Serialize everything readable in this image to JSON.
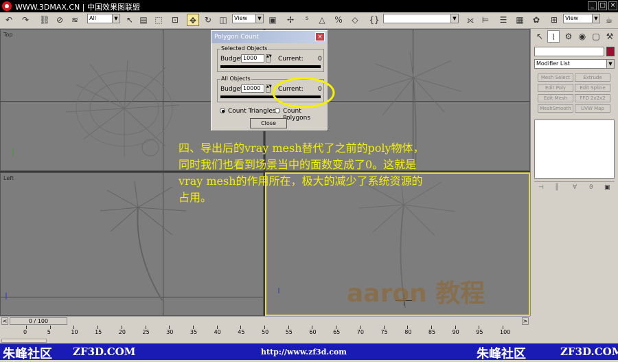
{
  "titlebar": {
    "text": "WWW.3DMAX.CN | 中国效果图联盟"
  },
  "toolbar": {
    "selection_filter": "All",
    "ref_coord": "View",
    "ref_coord_right": "View"
  },
  "viewports": {
    "top_label": "Top",
    "left_label": "Left"
  },
  "dialog": {
    "title": "Polygon Count",
    "selected": {
      "group_label": "Selected Objects",
      "budget_label": "Budget:",
      "budget_value": "1000",
      "current_label": "Current:",
      "current_value": "0"
    },
    "all": {
      "group_label": "All Objects",
      "budget_label": "Budget:",
      "budget_value": "10000",
      "current_label": "Current:",
      "current_value": "0"
    },
    "count_triangles": "Count Triangles",
    "count_polygons": "Count Polygons",
    "close_label": "Close",
    "selected_count_mode": "Count Triangles"
  },
  "command_panel": {
    "modifier_list": "Modifier List",
    "buttons": [
      "Mesh Select",
      "Extrude",
      "Edit Poly",
      "Edit Spline",
      "Edit Mesh",
      "FFD 2x2x2",
      "MeshSmooth",
      "UVW Map"
    ]
  },
  "annotation": {
    "line1": "四、导出后的vray mesh替代了之前的poly物体，",
    "line2": "同时我们也看到场景当中的面数变成了0。这就是",
    "line3": "vray mesh的作用所在，极大的减少了系统资源的",
    "line4": "占用。"
  },
  "watermark": "aaron 教程",
  "timeslider": {
    "frame": "0 / 100"
  },
  "trackbar": {
    "ticks": [
      "0",
      "5",
      "10",
      "15",
      "20",
      "25",
      "30",
      "35",
      "40",
      "45",
      "50",
      "55",
      "60",
      "65",
      "70",
      "75",
      "80",
      "85",
      "90",
      "95",
      "100"
    ]
  },
  "footer": {
    "left_brand": "朱峰社区",
    "left_url": "ZF3D.COM",
    "center_url": "http://www.zf3d.com",
    "right_brand": "朱峰社区",
    "right_url": "ZF3D.COM"
  },
  "colors": {
    "accent_yellow": "#f4f000",
    "footer_blue": "#1a1ab4",
    "swatch": "#9b1030"
  }
}
